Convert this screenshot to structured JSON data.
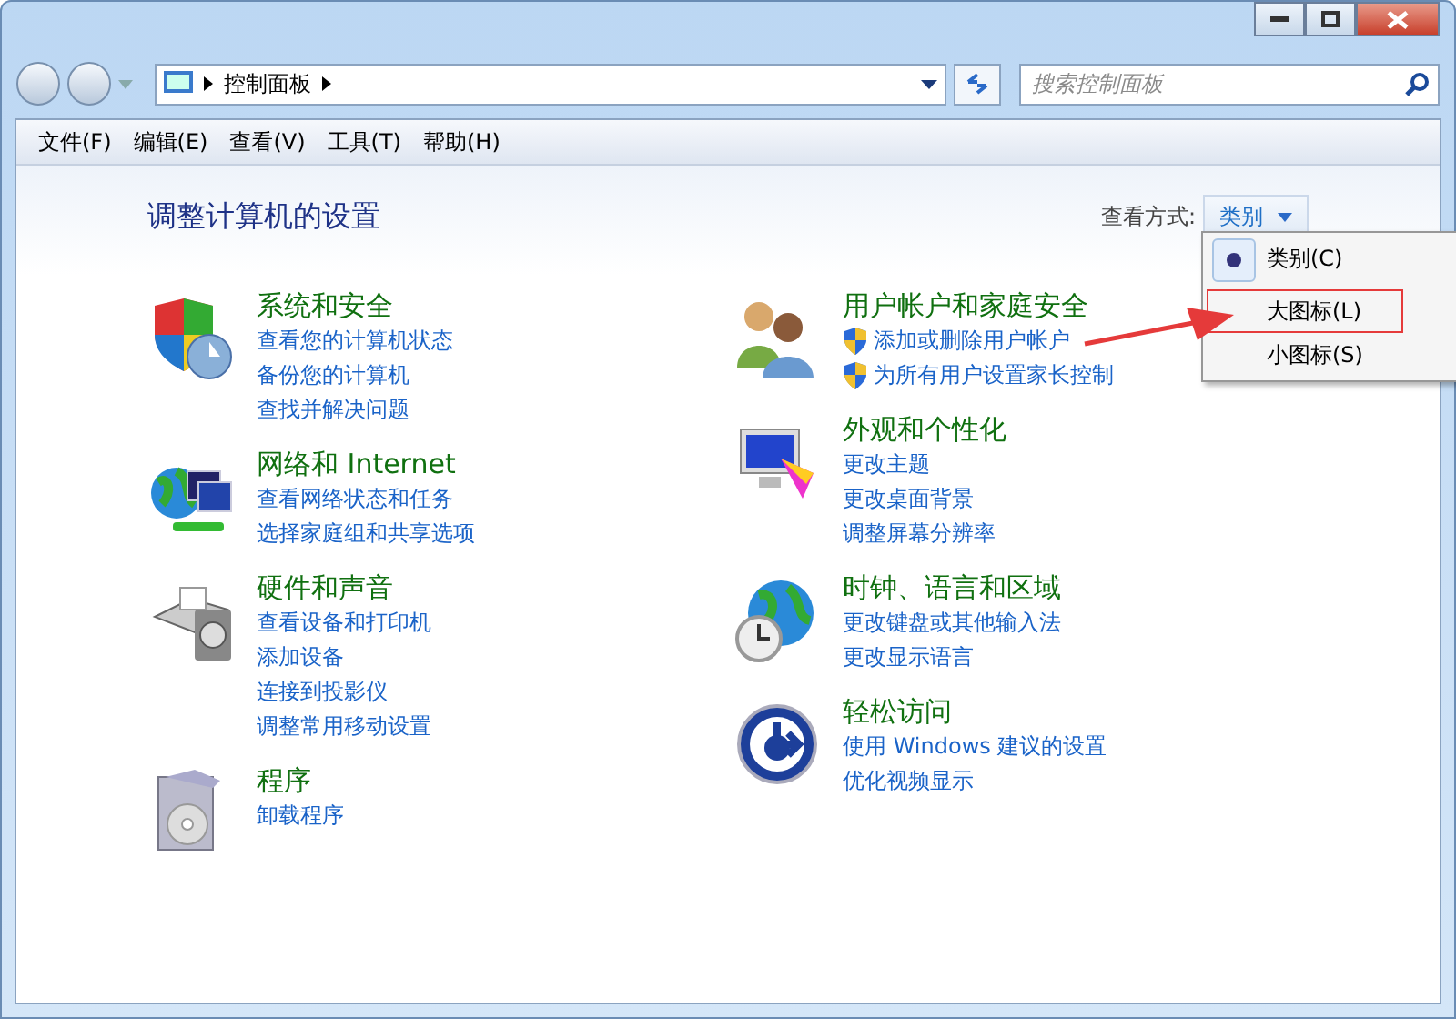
{
  "address": {
    "crumb": "控制面板"
  },
  "search": {
    "placeholder": "搜索控制面板"
  },
  "menu": [
    "文件(F)",
    "编辑(E)",
    "查看(V)",
    "工具(T)",
    "帮助(H)"
  ],
  "page_title": "调整计算机的设置",
  "view_by": {
    "label": "查看方式:",
    "value": "类别"
  },
  "view_menu": [
    {
      "label": "类别(C)",
      "selected": true,
      "highlighted": false
    },
    {
      "label": "大图标(L)",
      "selected": false,
      "highlighted": true
    },
    {
      "label": "小图标(S)",
      "selected": false,
      "highlighted": false
    }
  ],
  "columns": [
    [
      {
        "kind": "security",
        "title": "系统和安全",
        "links": [
          {
            "text": "查看您的计算机状态",
            "shield": false
          },
          {
            "text": "备份您的计算机",
            "shield": false
          },
          {
            "text": "查找并解决问题",
            "shield": false
          }
        ]
      },
      {
        "kind": "network",
        "title": "网络和 Internet",
        "links": [
          {
            "text": "查看网络状态和任务",
            "shield": false
          },
          {
            "text": "选择家庭组和共享选项",
            "shield": false
          }
        ]
      },
      {
        "kind": "hardware",
        "title": "硬件和声音",
        "links": [
          {
            "text": "查看设备和打印机",
            "shield": false
          },
          {
            "text": "添加设备",
            "shield": false
          },
          {
            "text": "连接到投影仪",
            "shield": false
          },
          {
            "text": "调整常用移动设置",
            "shield": false
          }
        ]
      },
      {
        "kind": "programs",
        "title": "程序",
        "links": [
          {
            "text": "卸载程序",
            "shield": false
          }
        ]
      }
    ],
    [
      {
        "kind": "users",
        "title": "用户帐户和家庭安全",
        "links": [
          {
            "text": "添加或删除用户帐户",
            "shield": true
          },
          {
            "text": "为所有用户设置家长控制",
            "shield": true
          }
        ]
      },
      {
        "kind": "appearance",
        "title": "外观和个性化",
        "links": [
          {
            "text": "更改主题",
            "shield": false
          },
          {
            "text": "更改桌面背景",
            "shield": false
          },
          {
            "text": "调整屏幕分辨率",
            "shield": false
          }
        ]
      },
      {
        "kind": "clock",
        "title": "时钟、语言和区域",
        "links": [
          {
            "text": "更改键盘或其他输入法",
            "shield": false
          },
          {
            "text": "更改显示语言",
            "shield": false
          }
        ]
      },
      {
        "kind": "access",
        "title": "轻松访问",
        "links": [
          {
            "text": "使用 Windows 建议的设置",
            "shield": false
          },
          {
            "text": "优化视频显示",
            "shield": false
          }
        ]
      }
    ]
  ]
}
